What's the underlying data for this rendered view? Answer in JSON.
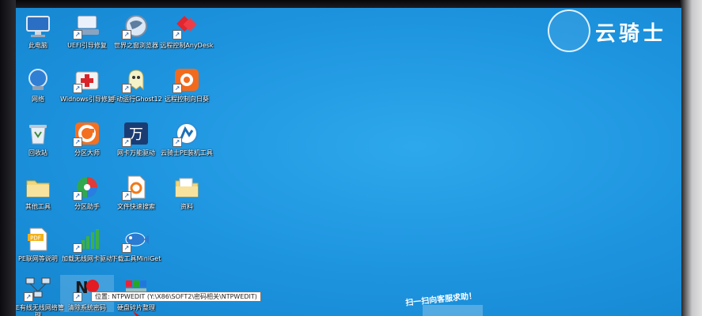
{
  "desktop": {
    "brand": {
      "text": "云骑士"
    },
    "qr_caption": "扫一扫向客服求助！",
    "tooltip": "位置: NTPWEDIT (Y:\\X86\\SOFT2\\密码相关\\NTPWEDIT)",
    "icons": [
      {
        "label": "此电脑",
        "icon": "computer-icon"
      },
      {
        "label": "UEFI引导修复",
        "icon": "uefi-repair-icon"
      },
      {
        "label": "世界之窗浏览器",
        "icon": "browser-globe-icon"
      },
      {
        "label": "远程控制AnyDesk",
        "icon": "anydesk-icon"
      },
      {
        "label": "网络",
        "icon": "network-icon"
      },
      {
        "label": "Widnows引导修复",
        "icon": "windows-repair-icon"
      },
      {
        "label": "手动运行Ghost12",
        "icon": "ghost-icon"
      },
      {
        "label": "远程控制向日葵",
        "icon": "sunflower-icon"
      },
      {
        "label": "回收站",
        "icon": "recycle-bin-icon"
      },
      {
        "label": "分区大师",
        "icon": "partition-master-icon"
      },
      {
        "label": "网卡万能驱动",
        "icon": "nic-driver-icon"
      },
      {
        "label": "云骑士PE装机工具",
        "icon": "installer-icon"
      },
      {
        "label": "其他工具",
        "icon": "folder-icon"
      },
      {
        "label": "分区助手",
        "icon": "partition-assistant-icon"
      },
      {
        "label": "文件快速搜索",
        "icon": "file-search-icon"
      },
      {
        "label": "资料",
        "icon": "folder-icon"
      },
      {
        "label": "PE联网等说明",
        "icon": "pdf-icon"
      },
      {
        "label": "加载无线网卡驱动",
        "icon": "wifi-signal-icon"
      },
      {
        "label": "下载工具MiniGet",
        "icon": "miniget-fish-icon"
      },
      {
        "label": "PE有线无线网络管理",
        "icon": "network-manager-icon"
      },
      {
        "label": "清除系统密码",
        "icon": "ntpwedit-icon"
      },
      {
        "label": "硬盘碎片整理",
        "icon": "defrag-icon"
      }
    ]
  }
}
